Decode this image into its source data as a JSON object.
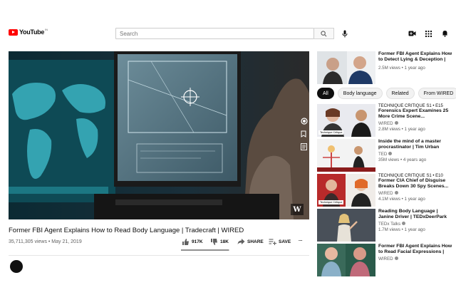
{
  "header": {
    "logo_text": "YouTube",
    "logo_country": "IN",
    "search_placeholder": "Search",
    "icons": [
      "search-icon",
      "mic-icon",
      "create-video-icon",
      "apps-grid-icon",
      "notifications-bell-icon"
    ]
  },
  "player": {
    "side_icons": [
      "circle-icon",
      "bookmark-icon",
      "list-icon"
    ],
    "watermark": "W"
  },
  "video": {
    "title": "Former FBI Agent Explains How to Read Body Language | Tradecraft | WIRED",
    "views_date": "35,711,305 views • May 21, 2019",
    "likes": "917K",
    "dislikes": "18K",
    "share_label": "SHARE",
    "save_label": "SAVE",
    "more_label": "...",
    "like_ratio": 0.98
  },
  "chips": [
    {
      "label": "All",
      "active": true
    },
    {
      "label": "Body language",
      "active": false
    },
    {
      "label": "Related",
      "active": false
    },
    {
      "label": "From WIRED",
      "active": false
    }
  ],
  "recommendations": [
    {
      "series": "",
      "title_lines": [
        "Former FBI Agent Explains How",
        "to Detect Lying & Deception |"
      ],
      "channel": "",
      "meta": "2.5M views • 1 year ago",
      "tag": ""
    },
    {
      "series": "TECHNIQUE CRITIQUE  S1 • E15",
      "title_lines": [
        "Forensics Expert Examines 25",
        "More Crime Scene..."
      ],
      "channel": "WIRED",
      "meta": "2.8M views • 1 year ago",
      "tag": "Technique Critique"
    },
    {
      "series": "",
      "title_lines": [
        "Inside the mind of a master",
        "procrastinator | Tim Urban"
      ],
      "channel": "TED",
      "meta": "35M views • 4 years ago",
      "tag": ""
    },
    {
      "series": "TECHNIQUE CRITIQUE  S1 • E10",
      "title_lines": [
        "Former CIA Chief of Disguise",
        "Breaks Down 30 Spy Scenes..."
      ],
      "channel": "WIRED",
      "meta": "4.1M views • 1 year ago",
      "tag": "Technique Critique"
    },
    {
      "series": "",
      "title_lines": [
        "Reading Body Language |",
        "Janine Driver | TEDxDeerPark"
      ],
      "channel": "TEDx Talks",
      "meta": "1.7M views • 1 year ago",
      "tag": ""
    },
    {
      "series": "",
      "title_lines": [
        "Former FBI Agent Explains How",
        "to Read Facial Expressions |"
      ],
      "channel": "WIRED",
      "meta": "",
      "tag": ""
    }
  ],
  "colors": {
    "brand_red": "#ff0000",
    "text_primary": "#0f0f0f",
    "text_secondary": "#606060",
    "chip_bg": "#f2f2f2"
  }
}
